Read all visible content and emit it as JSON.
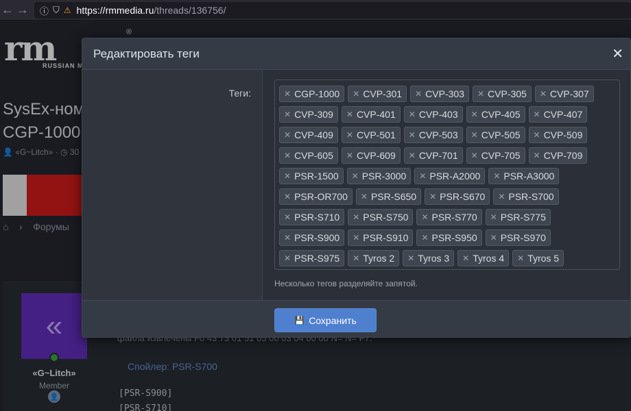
{
  "browser": {
    "back_icon": "back-arrow-icon",
    "forward_icon": "forward-arrow-icon",
    "url_host": "https://rmmedia.ru",
    "url_path": "/threads/136756/"
  },
  "site": {
    "logo_text": "rm",
    "logo_subtitle": "RUSSIAN M",
    "logo_mark": "®",
    "thread_title_line1": "SysEx-ном",
    "thread_title_line2": "CGP-1000",
    "meta_author": "«G~Litch»",
    "meta_date": "30",
    "breadcrumb_forums": "Форумы",
    "post_author": "«G~Litch»",
    "post_role": "Member",
    "post_text": "файла извлечены F0 43 73 01 51 05 00 03 04 00 00 N= N= F7.",
    "spoiler_label": "Спойлер: PSR-S700",
    "code_lines": [
      "[PSR-S900]",
      "[PSR-S710]"
    ]
  },
  "modal": {
    "title": "Редактировать теги",
    "field_label": "Теги:",
    "hint": "Несколько тегов разделяйте запятой.",
    "save_label": "Сохранить",
    "tags": [
      "CGP-1000",
      "CVP-301",
      "CVP-303",
      "CVP-305",
      "CVP-307",
      "CVP-309",
      "CVP-401",
      "CVP-403",
      "CVP-405",
      "CVP-407",
      "CVP-409",
      "CVP-501",
      "CVP-503",
      "CVP-505",
      "CVP-509",
      "CVP-605",
      "CVP-609",
      "CVP-701",
      "CVP-705",
      "CVP-709",
      "PSR-1500",
      "PSR-3000",
      "PSR-A2000",
      "PSR-A3000",
      "PSR-OR700",
      "PSR-S650",
      "PSR-S670",
      "PSR-S700",
      "PSR-S710",
      "PSR-S750",
      "PSR-S770",
      "PSR-S775",
      "PSR-S900",
      "PSR-S910",
      "PSR-S950",
      "PSR-S970",
      "PSR-S975",
      "Tyros 2",
      "Tyros 3",
      "Tyros 4",
      "Tyros 5"
    ]
  }
}
